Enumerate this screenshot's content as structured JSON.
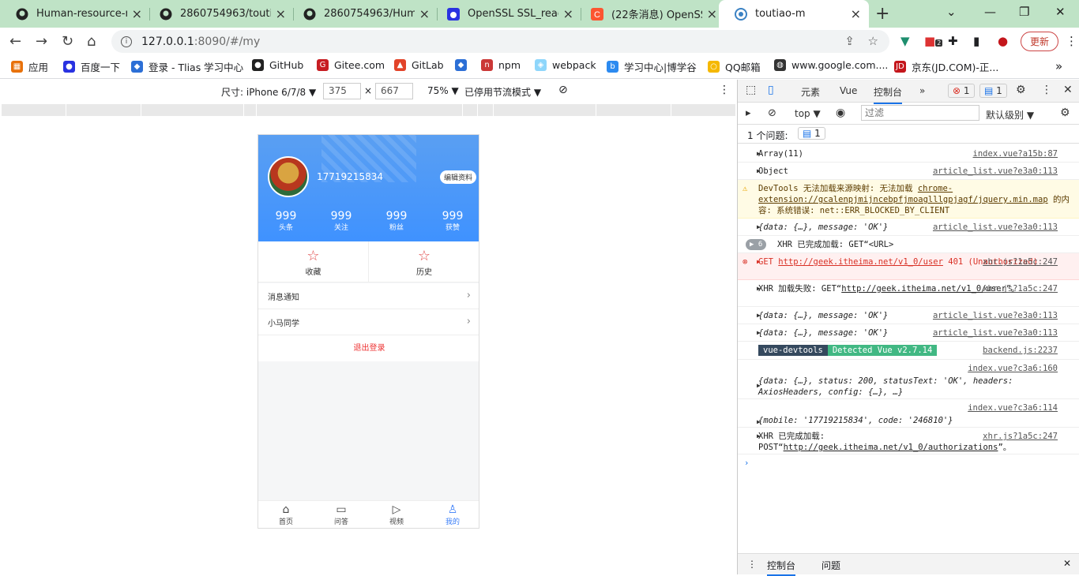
{
  "browser": {
    "tabs": [
      {
        "title": "Human-resource-ma",
        "icon": "github-icon"
      },
      {
        "title": "2860754963/toutiao",
        "icon": "github-icon"
      },
      {
        "title": "2860754963/Human",
        "icon": "github-icon"
      },
      {
        "title": "OpenSSL SSL_read: C",
        "icon": "baidu-icon"
      },
      {
        "title": "(22条消息) OpenSSL",
        "icon": "csdn-icon"
      },
      {
        "title": "toutiao-m",
        "icon": "vue-icon",
        "active": true
      }
    ],
    "address": {
      "host": "127.0.0.1",
      "path": ":8090/#/my"
    },
    "update_label": "更新",
    "ext_badge": "2",
    "bookmarks": [
      "应用",
      "百度一下",
      "登录 - Tlias 学习中心",
      "GitHub",
      "Gitee.com",
      "GitLab",
      "npm",
      "webpack",
      "学习中心|博学谷",
      "QQ邮箱",
      "www.google.com....",
      "京东(JD.COM)-正..."
    ]
  },
  "emulator": {
    "device_label": "尺寸: iPhone 6/7/8 ▼",
    "width": "375",
    "height": "667",
    "times": "×",
    "zoom": "75% ▼",
    "throttle": "已停用节流模式 ▼"
  },
  "app": {
    "username": "17719215834",
    "edit_label": "编辑资料",
    "stats": [
      {
        "value": "999",
        "label": "头条"
      },
      {
        "value": "999",
        "label": "关注"
      },
      {
        "value": "999",
        "label": "粉丝"
      },
      {
        "value": "999",
        "label": "获赞"
      }
    ],
    "grid": [
      {
        "label": "收藏"
      },
      {
        "label": "历史"
      }
    ],
    "cells": [
      {
        "label": "消息通知"
      },
      {
        "label": "小马同学"
      }
    ],
    "logout": "退出登录",
    "tabbar": [
      {
        "label": "首页",
        "icon": "home-icon"
      },
      {
        "label": "问答",
        "icon": "chat-icon"
      },
      {
        "label": "视频",
        "icon": "video-icon"
      },
      {
        "label": "我的",
        "icon": "user-icon",
        "active": true
      }
    ]
  },
  "devtools": {
    "tabs": [
      "元素",
      "Vue",
      "控制台"
    ],
    "error_count": "1",
    "msg_count": "1",
    "context": "top ▼",
    "filter_placeholder": "过滤",
    "levels": "默认级别 ▼",
    "issues_label": "1 个问题:",
    "issues_count": "1",
    "bottom_tabs": [
      "控制台",
      "问题"
    ],
    "logs": {
      "l1": {
        "text": "Array(11)",
        "src": "index.vue?a15b:87"
      },
      "l2": {
        "text": "Object",
        "src": "article_list.vue?e3a0:113"
      },
      "l3": {
        "prefix": "DevTools 无法加载来源映射: 无法加载 ",
        "link": "chrome-extension://gcalenpjmijncebpfjmoaglllgpjagf/jquery.min.map",
        "suffix": " 的内容: 系统错误: net::ERR_BLOCKED_BY_CLIENT"
      },
      "l4": {
        "text": "{data: {…}, message: 'OK'}",
        "src": "article_list.vue?e3a0:113"
      },
      "l5": {
        "count": "6",
        "text": "XHR 已完成加载: GET“<URL>"
      },
      "l6": {
        "prefix": "GET ",
        "link": "http://geek.itheima.net/v1_0/user",
        "suffix": " 401 (Unauthorized)",
        "src": "xhr.js?1a5c:247"
      },
      "l7": {
        "prefix": "XHR 加载失败: GET“",
        "link": "http://geek.itheima.net/v1_0/user",
        "suffix": "”。",
        "src": "xhr.js?1a5c:247"
      },
      "l8": {
        "text": "{data: {…}, message: 'OK'}",
        "src": "article_list.vue?e3a0:113"
      },
      "l9": {
        "text": "{data: {…}, message: 'OK'}",
        "src": "article_list.vue?e3a0:113"
      },
      "l10": {
        "badge1": "vue-devtools",
        "badge2": "Detected Vue v2.7.14",
        "src": "backend.js:2237"
      },
      "l11": {
        "src": "index.vue?c3a6:160",
        "text": "{data: {…}, status: 200, statusText: 'OK', headers: AxiosHeaders, config: {…}, …}"
      },
      "l12": {
        "src": "index.vue?c3a6:114",
        "text": "{mobile: '17719215834', code: '246810'}"
      },
      "l13": {
        "prefix": "XHR 已完成加载: POST“",
        "link": "http://geek.itheima.net/v1_0/authorizations",
        "suffix": "”。",
        "src": "xhr.js?1a5c:247"
      }
    }
  },
  "colors": {
    "accent": "#3a7ef8",
    "header_blue": "#4f9bf5",
    "logout_red": "#e33",
    "tabstrip": "#bfe3c6"
  }
}
